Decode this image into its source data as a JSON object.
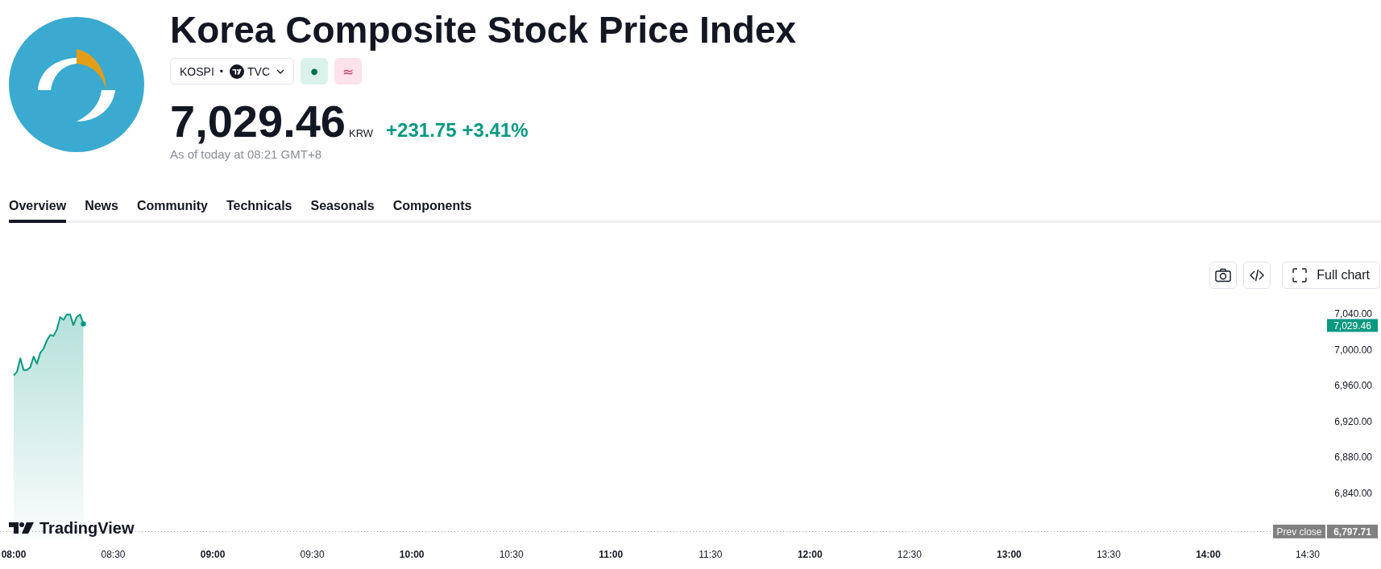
{
  "header": {
    "title": "Korea Composite Stock Price Index",
    "symbol": "KOSPI",
    "separator": "•",
    "exchange": "TVC",
    "badges": [
      {
        "kind": "market_status",
        "symbol": "●"
      },
      {
        "kind": "delay",
        "symbol": "≈"
      }
    ],
    "price": "7,029.46",
    "currency": "KRW",
    "change": "+231.75",
    "change_percent": "+3.41%",
    "gain": true,
    "timestamp": "As of today at 08:21 GMT+8"
  },
  "tabs": [
    {
      "label": "Overview",
      "selected": true
    },
    {
      "label": "News",
      "selected": false
    },
    {
      "label": "Community",
      "selected": false
    },
    {
      "label": "Technicals",
      "selected": false
    },
    {
      "label": "Seasonals",
      "selected": false
    },
    {
      "label": "Components",
      "selected": false
    }
  ],
  "chart_toolbar": {
    "buttons": [
      {
        "kind": "snapshot"
      },
      {
        "kind": "embed"
      },
      {
        "kind": "fullscreen",
        "label": "Full chart"
      }
    ]
  },
  "chart": {
    "logo": "TradingView",
    "chart_data": {
      "type": "area",
      "categories": [
        "08:00",
        null,
        null,
        null,
        null,
        null,
        null,
        null,
        null,
        null,
        null,
        null,
        null,
        null,
        null,
        null,
        null,
        null,
        null,
        null,
        null,
        null,
        null,
        null,
        null,
        null,
        null,
        null,
        null,
        null,
        "08:30",
        null,
        null,
        null,
        null,
        null,
        null,
        null,
        null,
        null,
        null,
        null,
        null,
        null,
        null,
        null,
        null,
        null,
        null,
        null,
        null,
        null,
        null,
        null,
        null,
        null,
        null,
        null,
        null,
        null,
        "09:00",
        null,
        null,
        null,
        null,
        null,
        null,
        null,
        null,
        null,
        null,
        null,
        null,
        null,
        null,
        null,
        null,
        null,
        null,
        null,
        null,
        null,
        null,
        null,
        null,
        null,
        null,
        null,
        null,
        null,
        "09:30",
        null,
        null,
        null,
        null,
        null,
        null,
        null,
        null,
        null,
        null,
        null,
        null,
        null,
        null,
        null,
        null,
        null,
        null,
        null,
        null,
        null,
        null,
        null,
        null,
        null,
        null,
        null,
        null,
        null,
        "10:00",
        null,
        null,
        null,
        null,
        null,
        null,
        null,
        null,
        null,
        null,
        null,
        null,
        null,
        null,
        null,
        null,
        null,
        null,
        null,
        null,
        null,
        null,
        null,
        null,
        null,
        null,
        null,
        null,
        null,
        "10:30",
        null,
        null,
        null,
        null,
        null,
        null,
        null,
        null,
        null,
        null,
        null,
        null,
        null,
        null,
        null,
        null,
        null,
        null,
        null,
        null,
        null,
        null,
        null,
        null,
        null,
        null,
        null,
        null,
        null,
        "11:00",
        null,
        null,
        null,
        null,
        null,
        null,
        null,
        null,
        null,
        null,
        null,
        null,
        null,
        null,
        null,
        null,
        null,
        null,
        null,
        null,
        null,
        null,
        null,
        null,
        null,
        null,
        null,
        null,
        null,
        "11:30",
        null,
        null,
        null,
        null,
        null,
        null,
        null,
        null,
        null,
        null,
        null,
        null,
        null,
        null,
        null,
        null,
        null,
        null,
        null,
        null,
        null,
        null,
        null,
        null,
        null,
        null,
        null,
        null,
        null,
        "12:00",
        null,
        null,
        null,
        null,
        null,
        null,
        null,
        null,
        null,
        null,
        null,
        null,
        null,
        null,
        null,
        null,
        null,
        null,
        null,
        null,
        null,
        null,
        null,
        null,
        null,
        null,
        null,
        null,
        null,
        "12:30",
        null,
        null,
        null,
        null,
        null,
        null,
        null,
        null,
        null,
        null,
        null,
        null,
        null,
        null,
        null,
        null,
        null,
        null,
        null,
        null,
        null,
        null,
        null,
        null,
        null,
        null,
        null,
        null,
        null,
        "13:00",
        null,
        null,
        null,
        null,
        null,
        null,
        null,
        null,
        null,
        null,
        null,
        null,
        null,
        null,
        null,
        null,
        null,
        null,
        null,
        null,
        null,
        null,
        null,
        null,
        null,
        null,
        null,
        null,
        null,
        "13:30",
        null,
        null,
        null,
        null,
        null,
        null,
        null,
        null,
        null,
        null,
        null,
        null,
        null,
        null,
        null,
        null,
        null,
        null,
        null,
        null,
        null,
        null,
        null,
        null,
        null,
        null,
        null,
        null,
        null,
        "14:00",
        null,
        null,
        null,
        null,
        null,
        null,
        null,
        null,
        null,
        null,
        null,
        null,
        null,
        null,
        null,
        null,
        null,
        null,
        null,
        null,
        null,
        null,
        null,
        null,
        null,
        null,
        null,
        null,
        null,
        "14:30"
      ],
      "values": [
        6972,
        6976,
        6991,
        6978,
        6978,
        6981,
        6993,
        6985,
        6997,
        7002,
        7011,
        7017,
        7016,
        7023,
        7037,
        7034,
        7040,
        7040,
        7028,
        7037,
        7040,
        7029.46,
        null,
        null,
        null,
        null,
        null,
        null,
        null,
        null,
        null,
        null,
        null,
        null,
        null,
        null,
        null,
        null,
        null,
        null,
        null,
        null,
        null,
        null,
        null,
        null,
        null,
        null,
        null,
        null,
        null,
        null,
        null,
        null,
        null,
        null,
        null,
        null,
        null,
        null,
        null,
        null,
        null,
        null,
        null,
        null,
        null,
        null,
        null,
        null,
        null,
        null,
        null,
        null,
        null,
        null,
        null,
        null,
        null,
        null,
        null,
        null,
        null,
        null,
        null,
        null,
        null,
        null,
        null,
        null,
        null,
        null,
        null,
        null,
        null,
        null,
        null,
        null,
        null,
        null,
        null,
        null,
        null,
        null,
        null,
        null,
        null,
        null,
        null,
        null,
        null,
        null,
        null,
        null,
        null,
        null,
        null,
        null,
        null,
        null,
        null,
        null,
        null,
        null,
        null,
        null,
        null,
        null,
        null,
        null,
        null,
        null,
        null,
        null,
        null,
        null,
        null,
        null,
        null,
        null,
        null,
        null,
        null,
        null,
        null,
        null,
        null,
        null,
        null,
        null,
        null,
        null,
        null,
        null,
        null,
        null,
        null,
        null,
        null,
        null,
        null,
        null,
        null,
        null,
        null,
        null,
        null,
        null,
        null,
        null,
        null,
        null,
        null,
        null,
        null,
        null,
        null,
        null,
        null,
        null,
        null,
        null,
        null,
        null,
        null,
        null,
        null,
        null,
        null,
        null,
        null,
        null,
        null,
        null,
        null,
        null,
        null,
        null,
        null,
        null,
        null,
        null,
        null,
        null,
        null,
        null,
        null,
        null,
        null,
        null,
        null,
        null,
        null,
        null,
        null,
        null,
        null,
        null,
        null,
        null,
        null,
        null,
        null,
        null,
        null,
        null,
        null,
        null,
        null,
        null,
        null,
        null,
        null,
        null,
        null,
        null,
        null,
        null,
        null,
        null,
        null,
        null,
        null,
        null,
        null,
        null,
        null,
        null,
        null,
        null,
        null,
        null,
        null,
        null,
        null,
        null,
        null,
        null,
        null,
        null,
        null,
        null,
        null,
        null,
        null,
        null,
        null,
        null,
        null,
        null,
        null,
        null,
        null,
        null,
        null,
        null,
        null,
        null,
        null,
        null,
        null,
        null,
        null,
        null,
        null,
        null,
        null,
        null,
        null,
        null,
        null,
        null,
        null,
        null,
        null,
        null,
        null,
        null,
        null,
        null,
        null,
        null,
        null,
        null,
        null,
        null,
        null,
        null,
        null,
        null,
        null,
        null,
        null,
        null,
        null,
        null,
        null,
        null,
        null,
        null,
        null,
        null,
        null,
        null,
        null,
        null,
        null,
        null,
        null,
        null,
        null,
        null,
        null,
        null,
        null,
        null,
        null,
        null,
        null,
        null,
        null,
        null,
        null,
        null,
        null,
        null,
        null,
        null,
        null,
        null,
        null,
        null,
        null,
        null,
        null,
        null,
        null,
        null,
        null,
        null,
        null,
        null,
        null,
        null,
        null,
        null,
        null,
        null,
        null,
        null,
        null,
        null,
        null,
        null,
        null,
        null,
        null,
        null,
        null,
        null,
        null,
        null,
        null,
        null,
        null,
        null,
        null,
        null,
        null,
        null,
        null
      ],
      "ylim": [
        6797.71,
        7040
      ],
      "yticks": [
        {
          "value": 6797.71,
          "label": "6,797.71"
        },
        {
          "value": 6840,
          "label": "6,840.00"
        },
        {
          "value": 6880,
          "label": "6,880.00"
        },
        {
          "value": 6920,
          "label": "6,920.00"
        },
        {
          "value": 6960,
          "label": "6,960.00"
        },
        {
          "value": 7000,
          "label": "7,000.00"
        },
        {
          "value": 7029.46,
          "label": "7,029.46"
        },
        {
          "value": 7040,
          "label": "7,040.00"
        }
      ],
      "ref_lines": [
        {
          "axis": "y",
          "value": 6797.71,
          "label": "Prev close"
        }
      ]
    }
  }
}
